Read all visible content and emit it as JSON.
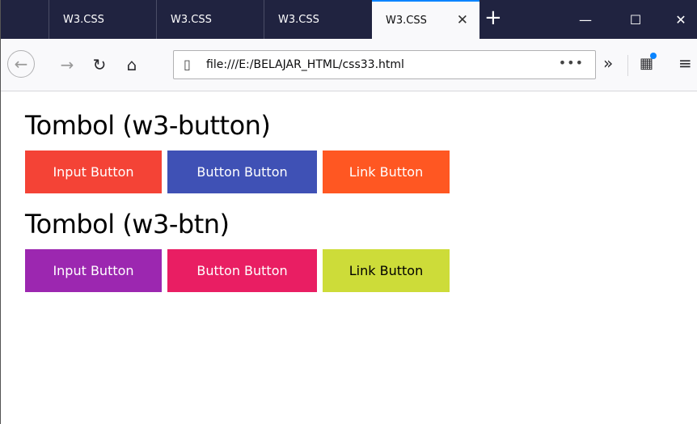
{
  "browser": {
    "tabs": [
      {
        "title": "W3.CSS",
        "active": false
      },
      {
        "title": "W3.CSS",
        "active": false
      },
      {
        "title": "W3.CSS",
        "active": false
      },
      {
        "title": "W3.CSS",
        "active": true
      }
    ],
    "url": "file:///E:/BELAJAR_HTML/css33.html",
    "colors": {
      "tabstrip": "#202340",
      "active_tab_accent": "#0a84ff"
    }
  },
  "page": {
    "section1": {
      "heading": "Tombol (w3-button)",
      "buttons": [
        {
          "label": "Input Button",
          "color": "#f44336",
          "text_color": "#ffffff"
        },
        {
          "label": "Button Button",
          "color": "#3f51b5",
          "text_color": "#ffffff"
        },
        {
          "label": "Link Button",
          "color": "#ff5722",
          "text_color": "#ffffff"
        }
      ]
    },
    "section2": {
      "heading": "Tombol (w3-btn)",
      "buttons": [
        {
          "label": "Input Button",
          "color": "#9c27b0",
          "text_color": "#ffffff"
        },
        {
          "label": "Button Button",
          "color": "#e91e63",
          "text_color": "#ffffff"
        },
        {
          "label": "Link Button",
          "color": "#cddc39",
          "text_color": "#000000"
        }
      ]
    }
  }
}
